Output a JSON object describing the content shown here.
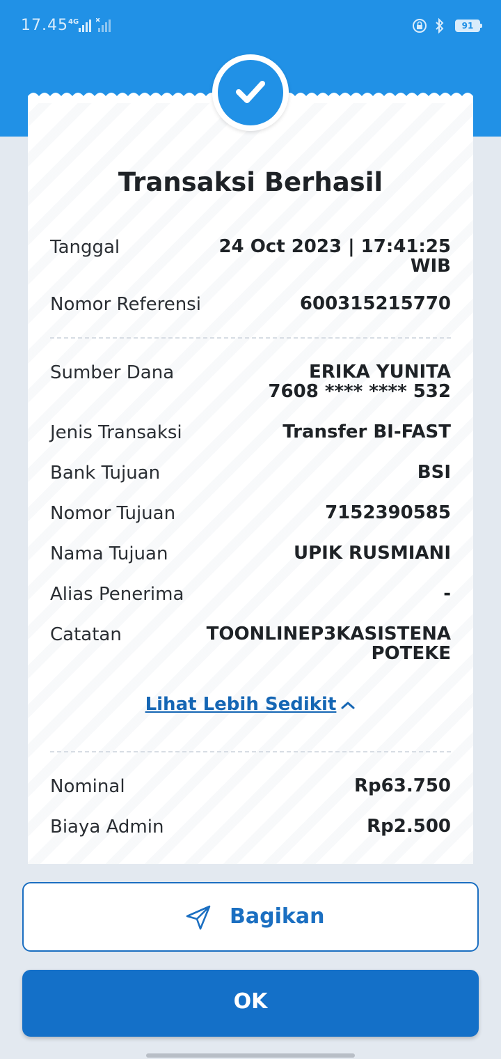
{
  "status_bar": {
    "time": "17.45",
    "network": "4G",
    "battery": "91"
  },
  "receipt": {
    "title": "Transaksi Berhasil",
    "rows": [
      {
        "label": "Tanggal",
        "value_lines": [
          "24 Oct 2023 | 17:41:25",
          "WIB"
        ]
      },
      {
        "label": "Nomor Referensi",
        "value_lines": [
          "600315215770"
        ]
      },
      {
        "label": "Sumber Dana",
        "value_lines": [
          "ERIKA YUNITA",
          "7608 **** **** 532"
        ]
      },
      {
        "label": "Jenis Transaksi",
        "value_lines": [
          "Transfer BI-FAST"
        ]
      },
      {
        "label": "Bank Tujuan",
        "value_lines": [
          "BSI"
        ]
      },
      {
        "label": "Nomor Tujuan",
        "value_lines": [
          "7152390585"
        ]
      },
      {
        "label": "Nama Tujuan",
        "value_lines": [
          "UPIK RUSMIANI"
        ]
      },
      {
        "label": "Alias Penerima",
        "value_lines": [
          "-"
        ]
      },
      {
        "label": "Catatan",
        "value_lines": [
          "TOONLINEP3KASISTENA",
          "POTEKE"
        ]
      },
      {
        "label": "Nominal",
        "value_lines": [
          "Rp63.750"
        ]
      },
      {
        "label": "Biaya Admin",
        "value_lines": [
          "Rp2.500"
        ]
      }
    ],
    "toggle_label": "Lihat Lebih Sedikit"
  },
  "actions": {
    "share_label": "Bagikan",
    "ok_label": "OK"
  },
  "colors": {
    "primary": "#2191e6",
    "button": "#1470c8",
    "link": "#1566b4"
  },
  "icons": [
    "check-icon",
    "share-send-icon",
    "chevron-up-icon",
    "lock-icon",
    "bluetooth-icon",
    "signal-icon",
    "battery-icon"
  ]
}
